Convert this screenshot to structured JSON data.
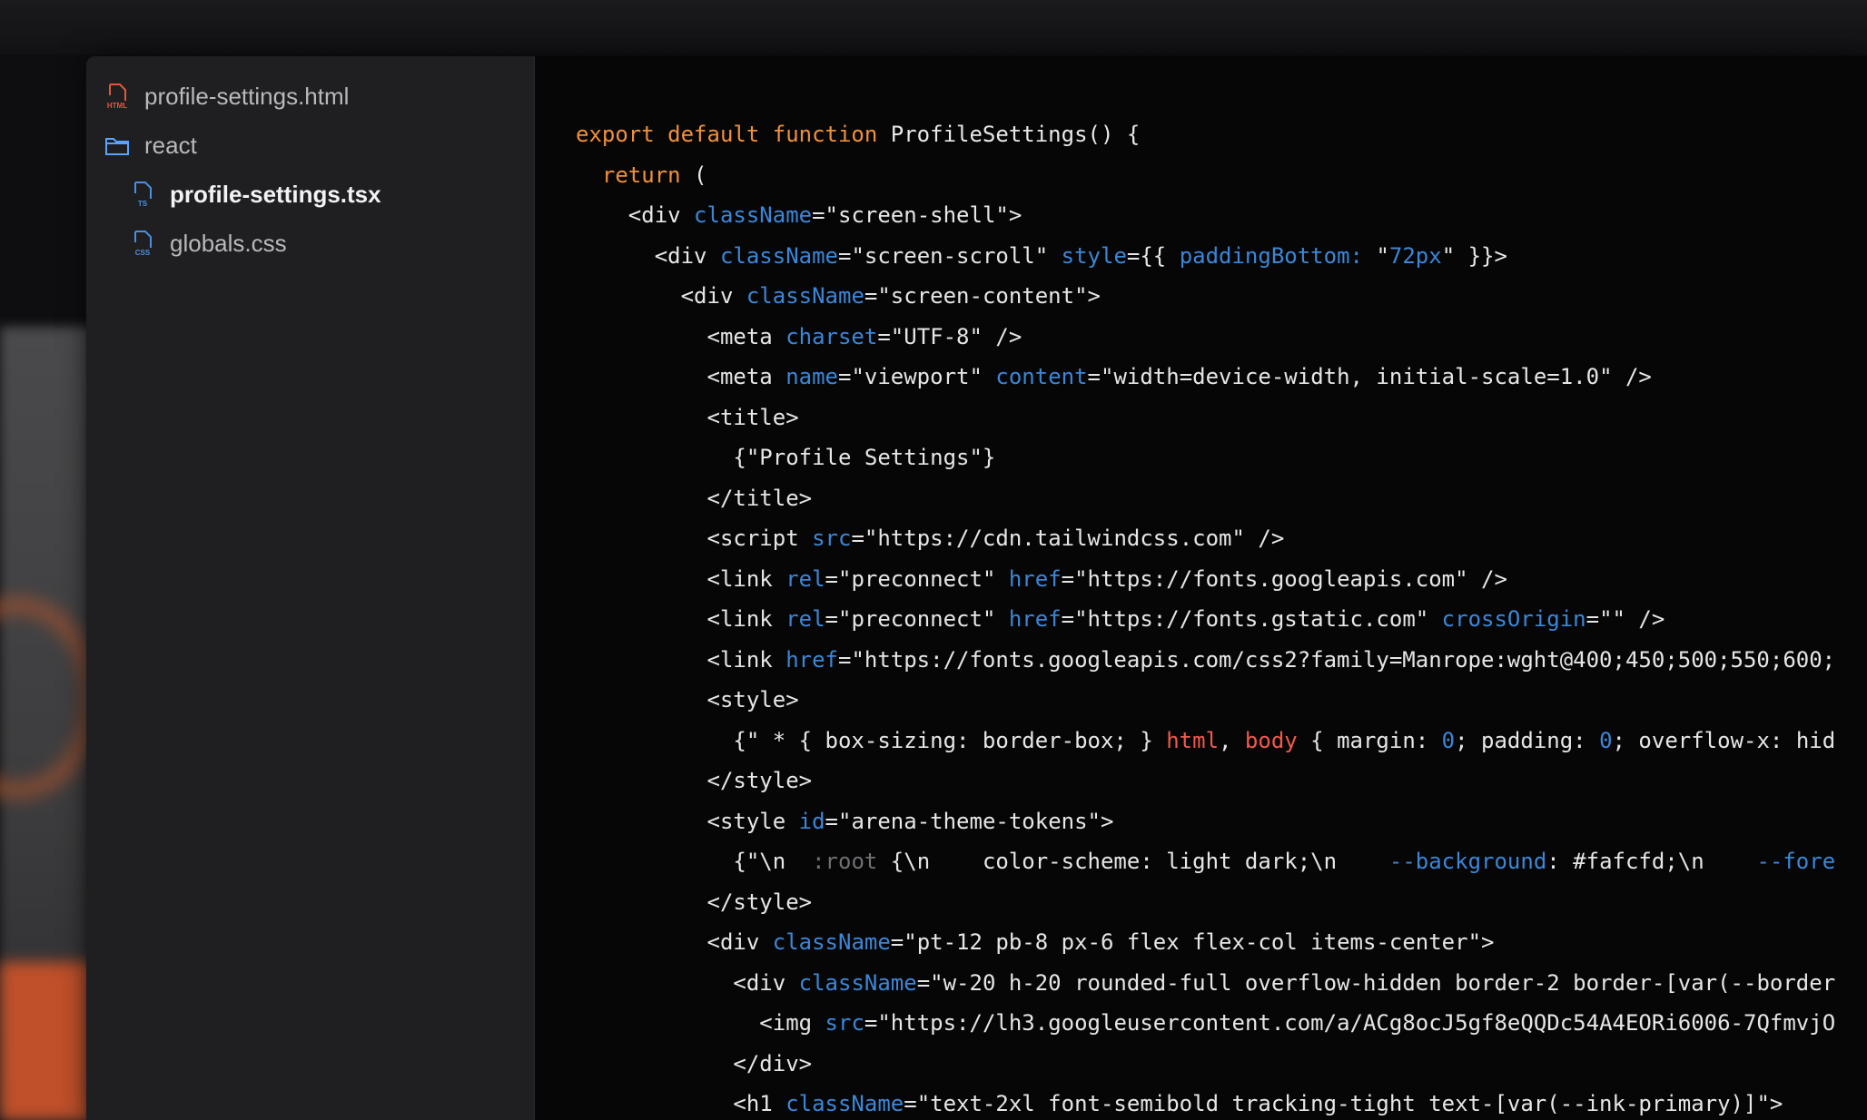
{
  "file_tree": [
    {
      "name": "profile-settings.html",
      "icon": "html-file-icon",
      "badge": "HTML",
      "color": "#e8563a",
      "level": 0,
      "active": false
    },
    {
      "name": "react",
      "icon": "folder-icon",
      "badge": "",
      "color": "#5aa3ff",
      "level": 0,
      "active": false
    },
    {
      "name": "profile-settings.tsx",
      "icon": "tsx-file-icon",
      "badge": "TS",
      "color": "#4a8fe0",
      "level": 1,
      "active": true
    },
    {
      "name": "globals.css",
      "icon": "css-file-icon",
      "badge": "CSS",
      "color": "#4a8fe0",
      "level": 1,
      "active": false
    }
  ],
  "code_lines": [
    [
      [
        "kw",
        "export default function "
      ],
      [
        "fn",
        "ProfileSettings() {"
      ]
    ],
    [
      [
        "kw",
        "  return "
      ],
      [
        "fn",
        "("
      ]
    ],
    [
      [
        "tag",
        "    <div "
      ],
      [
        "attr",
        "className"
      ],
      [
        "tag",
        "="
      ],
      [
        "str",
        "\"screen-shell\""
      ],
      [
        "tag",
        ">"
      ]
    ],
    [
      [
        "tag",
        "      <div "
      ],
      [
        "attr",
        "className"
      ],
      [
        "tag",
        "="
      ],
      [
        "str",
        "\"screen-scroll\" "
      ],
      [
        "attr",
        "style"
      ],
      [
        "tag",
        "={{ "
      ],
      [
        "attr",
        "paddingBottom: "
      ],
      [
        "str",
        "\""
      ],
      [
        "attr",
        "72px"
      ],
      [
        "str",
        "\""
      ],
      [
        "tag",
        " }}>"
      ]
    ],
    [
      [
        "tag",
        "        <div "
      ],
      [
        "attr",
        "className"
      ],
      [
        "tag",
        "="
      ],
      [
        "str",
        "\"screen-content\""
      ],
      [
        "tag",
        ">"
      ]
    ],
    [
      [
        "tag",
        "          <meta "
      ],
      [
        "attr",
        "charset"
      ],
      [
        "tag",
        "="
      ],
      [
        "str",
        "\"UTF-8\""
      ],
      [
        "tag",
        " />"
      ]
    ],
    [
      [
        "tag",
        "          <meta "
      ],
      [
        "attr",
        "name"
      ],
      [
        "tag",
        "="
      ],
      [
        "str",
        "\"viewport\" "
      ],
      [
        "attr",
        "content"
      ],
      [
        "tag",
        "="
      ],
      [
        "str",
        "\"width=device-width, initial-scale=1.0\""
      ],
      [
        "tag",
        " />"
      ]
    ],
    [
      [
        "tag",
        "          <title>"
      ]
    ],
    [
      [
        "str",
        "            {\"Profile Settings\"}"
      ]
    ],
    [
      [
        "tag",
        "          </title>"
      ]
    ],
    [
      [
        "tag",
        "          <script "
      ],
      [
        "attr",
        "src"
      ],
      [
        "tag",
        "="
      ],
      [
        "str",
        "\"https://cdn.tailwindcss.com\""
      ],
      [
        "tag",
        " />"
      ]
    ],
    [
      [
        "tag",
        "          <link "
      ],
      [
        "attr",
        "rel"
      ],
      [
        "tag",
        "="
      ],
      [
        "str",
        "\"preconnect\" "
      ],
      [
        "attr",
        "href"
      ],
      [
        "tag",
        "="
      ],
      [
        "str",
        "\"https://fonts.googleapis.com\""
      ],
      [
        "tag",
        " />"
      ]
    ],
    [
      [
        "tag",
        "          <link "
      ],
      [
        "attr",
        "rel"
      ],
      [
        "tag",
        "="
      ],
      [
        "str",
        "\"preconnect\" "
      ],
      [
        "attr",
        "href"
      ],
      [
        "tag",
        "="
      ],
      [
        "str",
        "\"https://fonts.gstatic.com\" "
      ],
      [
        "attr",
        "crossOrigin"
      ],
      [
        "tag",
        "=\"\" />"
      ]
    ],
    [
      [
        "tag",
        "          <link "
      ],
      [
        "attr",
        "href"
      ],
      [
        "tag",
        "="
      ],
      [
        "str",
        "\"https://fonts.googleapis.com/css2?family=Manrope:wght@400;450;500;550;600;"
      ]
    ],
    [
      [
        "tag",
        "          <style>"
      ]
    ],
    [
      [
        "str",
        "            {\" * { box-sizing: border-box; } "
      ],
      [
        "sel",
        "html"
      ],
      [
        "str",
        ", "
      ],
      [
        "sel",
        "body"
      ],
      [
        "str",
        " { margin: "
      ],
      [
        "attr",
        "0"
      ],
      [
        "str",
        "; padding: "
      ],
      [
        "attr",
        "0"
      ],
      [
        "str",
        "; overflow-x: hid"
      ]
    ],
    [
      [
        "tag",
        "          </style>"
      ]
    ],
    [
      [
        "tag",
        "          <style "
      ],
      [
        "attr",
        "id"
      ],
      [
        "tag",
        "="
      ],
      [
        "str",
        "\"arena-theme-tokens\""
      ],
      [
        "tag",
        ">"
      ]
    ],
    [
      [
        "str",
        "            {\"\\n  "
      ],
      [
        "dim",
        ":root"
      ],
      [
        "str",
        " {\\n    color-scheme: light dark;\\n    "
      ],
      [
        "var",
        "--background"
      ],
      [
        "str",
        ": #fafcfd;\\n    "
      ],
      [
        "var",
        "--fore"
      ]
    ],
    [
      [
        "tag",
        "          </style>"
      ]
    ],
    [
      [
        "tag",
        "          <div "
      ],
      [
        "attr",
        "className"
      ],
      [
        "tag",
        "="
      ],
      [
        "str",
        "\"pt-12 pb-8 px-6 flex flex-col items-center\""
      ],
      [
        "tag",
        ">"
      ]
    ],
    [
      [
        "tag",
        "            <div "
      ],
      [
        "attr",
        "className"
      ],
      [
        "tag",
        "="
      ],
      [
        "str",
        "\"w-20 h-20 rounded-full overflow-hidden border-2 border-[var(--border"
      ]
    ],
    [
      [
        "tag",
        "              <img "
      ],
      [
        "attr",
        "src"
      ],
      [
        "tag",
        "="
      ],
      [
        "str",
        "\"https://lh3.googleusercontent.com/a/ACg8ocJ5gf8eQQDc54A4EORi6006-7QfmvjO"
      ]
    ],
    [
      [
        "tag",
        "            </div>"
      ]
    ],
    [
      [
        "tag",
        "            <h1 "
      ],
      [
        "attr",
        "className"
      ],
      [
        "tag",
        "="
      ],
      [
        "str",
        "\"text-2xl font-semibold tracking-tight text-[var(--ink-primary)]\""
      ],
      [
        "tag",
        ">"
      ]
    ]
  ]
}
